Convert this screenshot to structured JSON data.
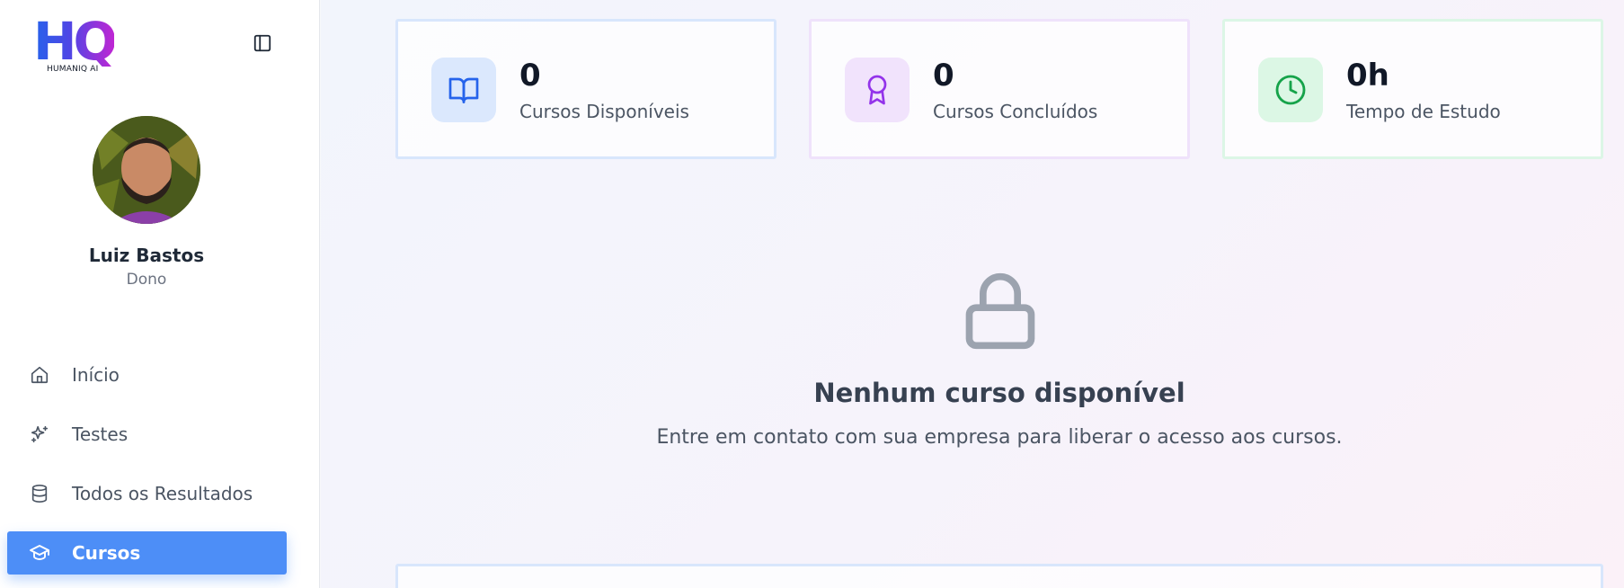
{
  "brand": {
    "logo_text": "HQ",
    "logo_sub": "HUMANIQ AI"
  },
  "sidebar": {
    "profile": {
      "name": "Luiz Bastos",
      "role": "Dono"
    },
    "items": [
      {
        "label": "Início",
        "icon": "home-icon",
        "active": false
      },
      {
        "label": "Testes",
        "icon": "sparkles-icon",
        "active": false
      },
      {
        "label": "Todos os Resultados",
        "icon": "database-icon",
        "active": false
      },
      {
        "label": "Cursos",
        "icon": "graduation-cap-icon",
        "active": true
      }
    ]
  },
  "stats": [
    {
      "value": "0",
      "label": "Cursos Disponíveis",
      "icon": "book-open-icon",
      "color": "#2563eb",
      "bg": "#dbe8fd"
    },
    {
      "value": "0",
      "label": "Cursos Concluídos",
      "icon": "award-icon",
      "color": "#9333ea",
      "bg": "#f1e3fc"
    },
    {
      "value": "0h",
      "label": "Tempo de Estudo",
      "icon": "clock-icon",
      "color": "#16a34a",
      "bg": "#dcf7e5"
    }
  ],
  "empty_state": {
    "icon": "lock-icon",
    "title": "Nenhum curso disponível",
    "description": "Entre em contato com sua empresa para liberar o acesso aos cursos."
  },
  "colors": {
    "accent": "#4d8ef7",
    "lock_gray": "#9ca3af"
  }
}
